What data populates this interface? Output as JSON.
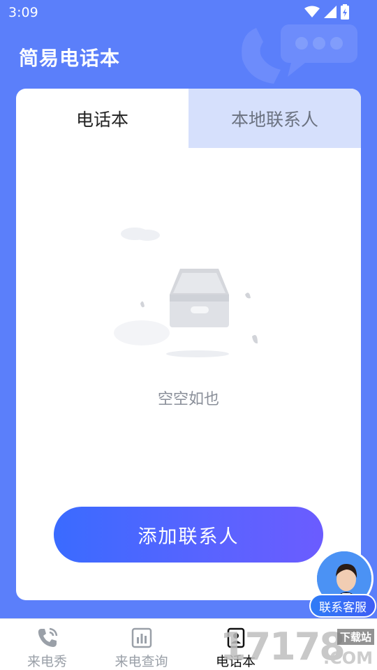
{
  "status_bar": {
    "time": "3:09"
  },
  "header": {
    "title": "简易电话本"
  },
  "tabs": [
    {
      "label": "电话本",
      "active": true
    },
    {
      "label": "本地联系人",
      "active": false
    }
  ],
  "empty_state": {
    "text": "空空如也"
  },
  "add_button": {
    "label": "添加联系人"
  },
  "customer_service": {
    "label": "联系客服"
  },
  "bottom_nav": [
    {
      "label": "来电秀",
      "icon": "phone-call-icon",
      "active": false
    },
    {
      "label": "来电查询",
      "icon": "bar-chart-icon",
      "active": false
    },
    {
      "label": "电话本",
      "icon": "contacts-icon",
      "active": true
    }
  ],
  "watermark": {
    "number": "17178",
    "badge": "下载站",
    "suffix": ".COM"
  },
  "colors": {
    "background": "#5b7ffa",
    "tab_inactive": "#d6e0fc",
    "button_start": "#3a6bff",
    "button_end": "#6b5cff"
  }
}
